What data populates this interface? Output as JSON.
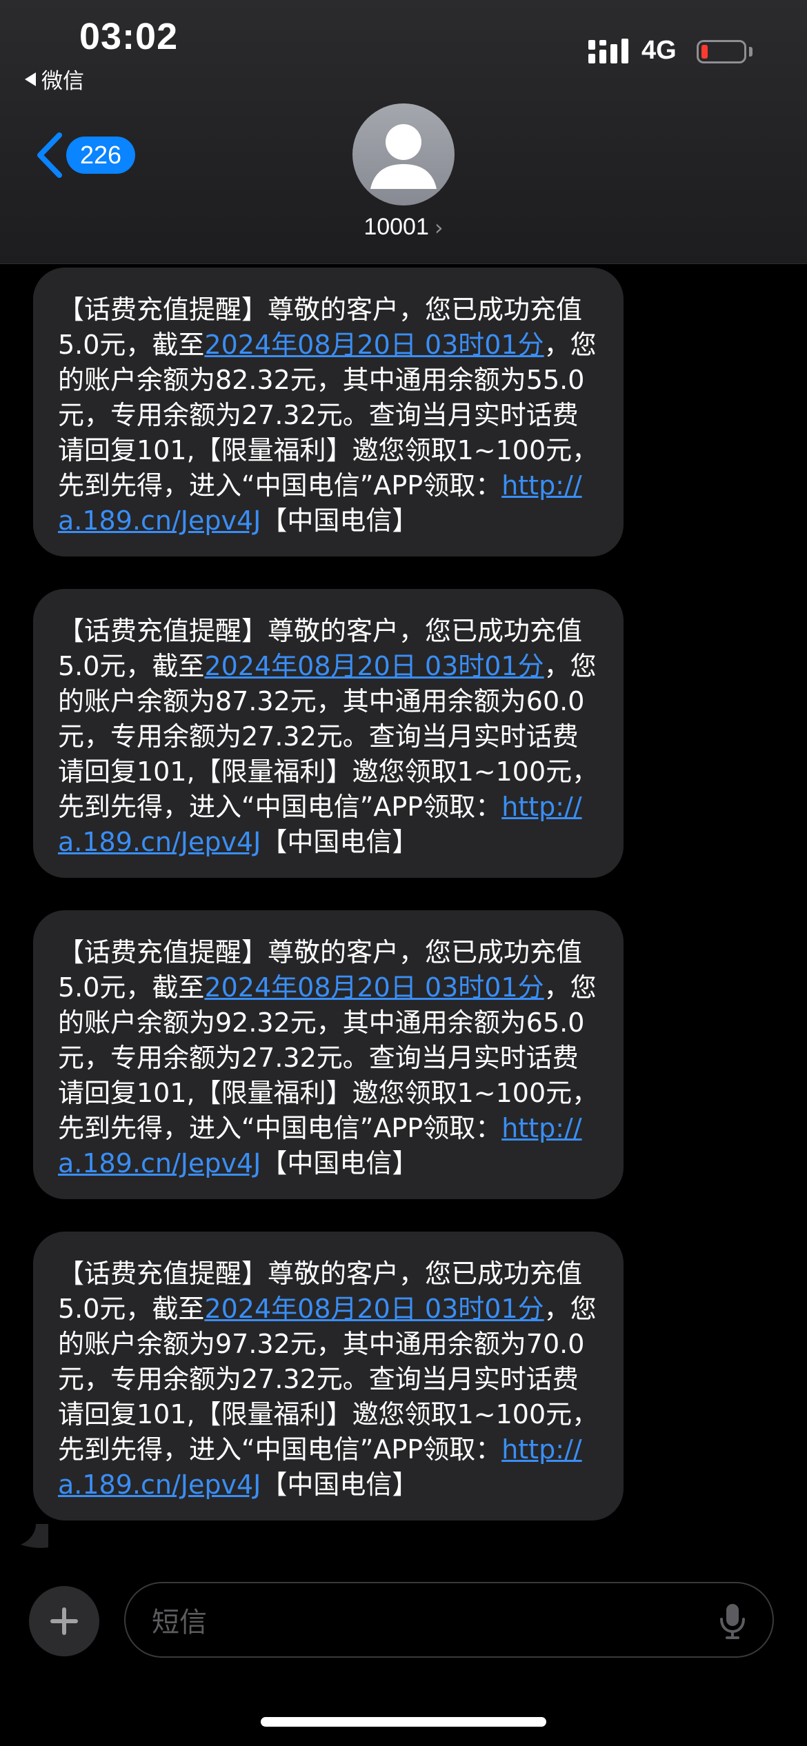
{
  "status_bar": {
    "time": "03:02",
    "back_app_label": "微信",
    "network": "4G",
    "battery_level": 0.1
  },
  "header": {
    "back_count": "226",
    "contact_name": "10001",
    "chevron": "›"
  },
  "messages": [
    {
      "part1": "【话费充值提醒】尊敬的客户，您已成功充值5.0元，截至",
      "date_link": "2024年08月20日 03时01分",
      "part2": "，您的账户余额为82.32元，其中通用余额为55.0元，专用余额为27.32元。查询当月实时话费请回复101,【限量福利】邀您领取1~100元，先到先得，进入“中国电信”APP领取：",
      "url_link": "http://a.189.cn/Jepv4J",
      "part3": "【中国电信】"
    },
    {
      "part1": "【话费充值提醒】尊敬的客户，您已成功充值5.0元，截至",
      "date_link": "2024年08月20日 03时01分",
      "part2": "，您的账户余额为87.32元，其中通用余额为60.0元，专用余额为27.32元。查询当月实时话费请回复101,【限量福利】邀您领取1~100元，先到先得，进入“中国电信”APP领取：",
      "url_link": "http://a.189.cn/Jepv4J",
      "part3": "【中国电信】"
    },
    {
      "part1": "【话费充值提醒】尊敬的客户，您已成功充值5.0元，截至",
      "date_link": "2024年08月20日 03时01分",
      "part2": "，您的账户余额为92.32元，其中通用余额为65.0元，专用余额为27.32元。查询当月实时话费请回复101,【限量福利】邀您领取1~100元，先到先得，进入“中国电信”APP领取：",
      "url_link": "http://a.189.cn/Jepv4J",
      "part3": "【中国电信】"
    },
    {
      "part1": "【话费充值提醒】尊敬的客户，您已成功充值5.0元，截至",
      "date_link": "2024年08月20日 03时01分",
      "part2": "，您的账户余额为97.32元，其中通用余额为70.0元，专用余额为27.32元。查询当月实时话费请回复101,【限量福利】邀您领取1~100元，先到先得，进入“中国电信”APP领取：",
      "url_link": "http://a.189.cn/Jepv4J",
      "part3": "【中国电信】"
    }
  ],
  "composer": {
    "placeholder": "短信"
  },
  "colors": {
    "accent": "#0a84ff",
    "link": "#3a8ef5",
    "bubble": "#262628",
    "battery_low": "#ff3b30"
  }
}
